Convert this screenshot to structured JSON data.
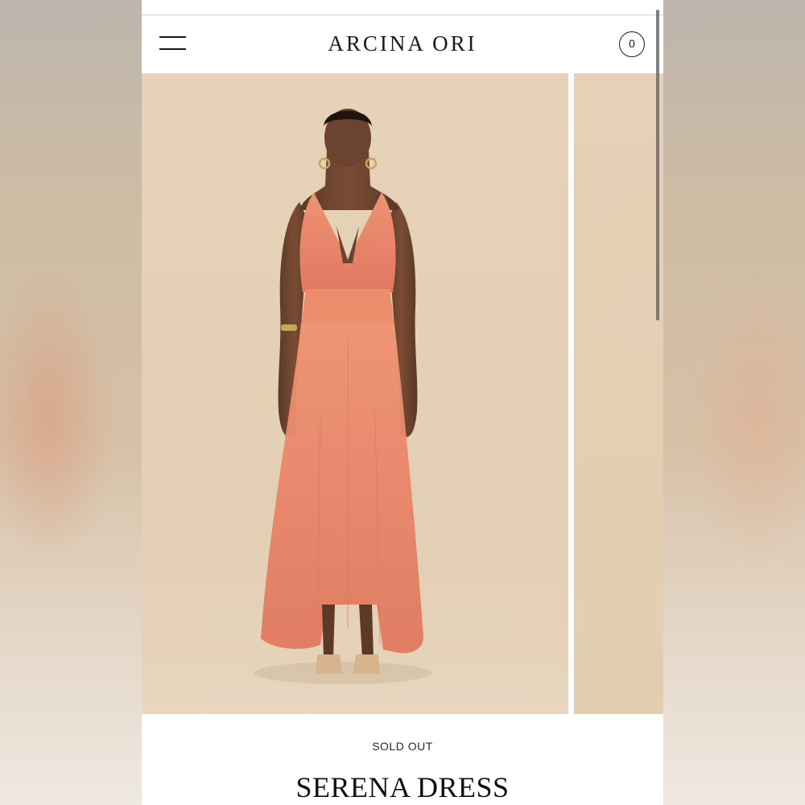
{
  "header": {
    "brand": "ARCINA ORI",
    "cart_count": "0"
  },
  "gallery": {
    "main_image": "model wearing coral halter maxi dress",
    "next_image": "next product image (partially visible)"
  },
  "product": {
    "status": "SOLD OUT",
    "title": "SERENA DRESS"
  },
  "colors": {
    "dress": "#e8896b",
    "background": "#e4d0b5",
    "text": "#111111"
  },
  "icons": {
    "menu": "hamburger-menu-icon",
    "cart": "cart-circle-icon"
  }
}
